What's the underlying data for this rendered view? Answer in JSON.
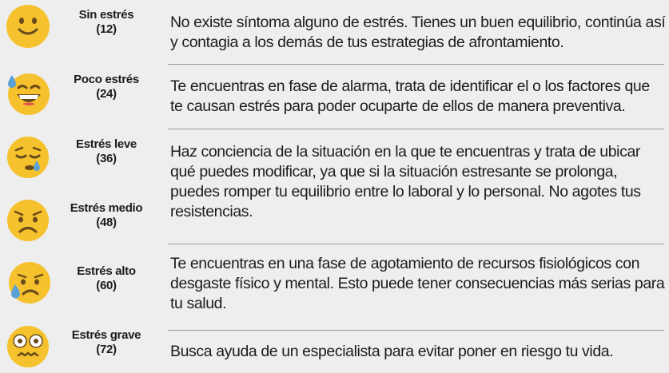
{
  "rows": [
    {
      "level": "Sin estrés",
      "score": "(12)",
      "face_icon": "smiling-face-icon",
      "text": "No existe síntoma alguno de estrés. Tienes un buen equilibrio, continúa así y contagia a los demás de tus estrategias de afrontamiento."
    },
    {
      "level": "Poco estrés",
      "score": "(24)",
      "face_icon": "grinning-face-with-sweat-icon",
      "text": "Te encuentras en fase de alarma, trata de identificar el o los factores que te causan estrés para poder ocuparte de ellos de manera preventiva."
    },
    {
      "level": "Estrés leve",
      "score": "(36)",
      "face_icon": "sleepy-face-icon",
      "text": "Haz conciencia de la situación en la que te encuentras y trata de ubicar qué puedes modificar, ya que si la situación estresante se prolonga, puedes romper tu equilibrio entre lo laboral y lo personal. No agotes tus resistencias."
    },
    {
      "level": "Estrés medio",
      "score": "(48)",
      "face_icon": "worried-face-icon"
    },
    {
      "level": "Estrés alto",
      "score": "(60)",
      "face_icon": "crying-face-icon",
      "text": "Te encuentras en una fase de agotamiento de recursos fisiológicos con desgaste físico y mental. Esto puede tener consecuencias más serias para tu salud."
    },
    {
      "level": "Estrés grave",
      "score": "(72)",
      "face_icon": "flushed-face-icon",
      "text": "Busca ayuda de un especialista para evitar poner en riesgo tu vida."
    }
  ],
  "colors": {
    "face_yellow": "#f5c22d",
    "face_feature": "#6b4a1a",
    "tear_blue": "#5aa0d8",
    "divider": "#9a9a9a",
    "background": "#efeeee"
  }
}
